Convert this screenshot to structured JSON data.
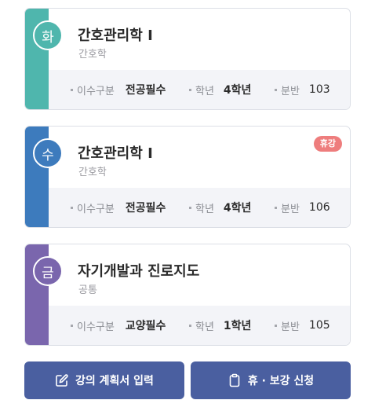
{
  "courses": [
    {
      "day": "화",
      "color": "#4fb6ad",
      "title": "간호관리학 Ⅰ",
      "department": "간호학",
      "badge": "",
      "fields": [
        {
          "label": "이수구분",
          "value": "전공필수"
        },
        {
          "label": "학년",
          "value": "4학년"
        },
        {
          "label": "분반",
          "value": "103"
        }
      ]
    },
    {
      "day": "수",
      "color": "#3d7bbd",
      "title": "간호관리학 Ⅰ",
      "department": "간호학",
      "badge": "휴강",
      "fields": [
        {
          "label": "이수구분",
          "value": "전공필수"
        },
        {
          "label": "학년",
          "value": "4학년"
        },
        {
          "label": "분반",
          "value": "106"
        }
      ]
    },
    {
      "day": "금",
      "color": "#7a66ad",
      "title": "자기개발과 진로지도",
      "department": "공통",
      "badge": "",
      "fields": [
        {
          "label": "이수구분",
          "value": "교양필수"
        },
        {
          "label": "학년",
          "value": "1학년"
        },
        {
          "label": "분반",
          "value": "105"
        }
      ]
    }
  ],
  "actions": {
    "plan_button": {
      "label": "강의 계획서 입력",
      "icon": "edit-icon"
    },
    "makeup_button": {
      "label": "휴 · 보강 신청",
      "icon": "clipboard-icon"
    }
  },
  "colors": {
    "button": "#4a5fa0",
    "badge": "#ee7d7d"
  }
}
